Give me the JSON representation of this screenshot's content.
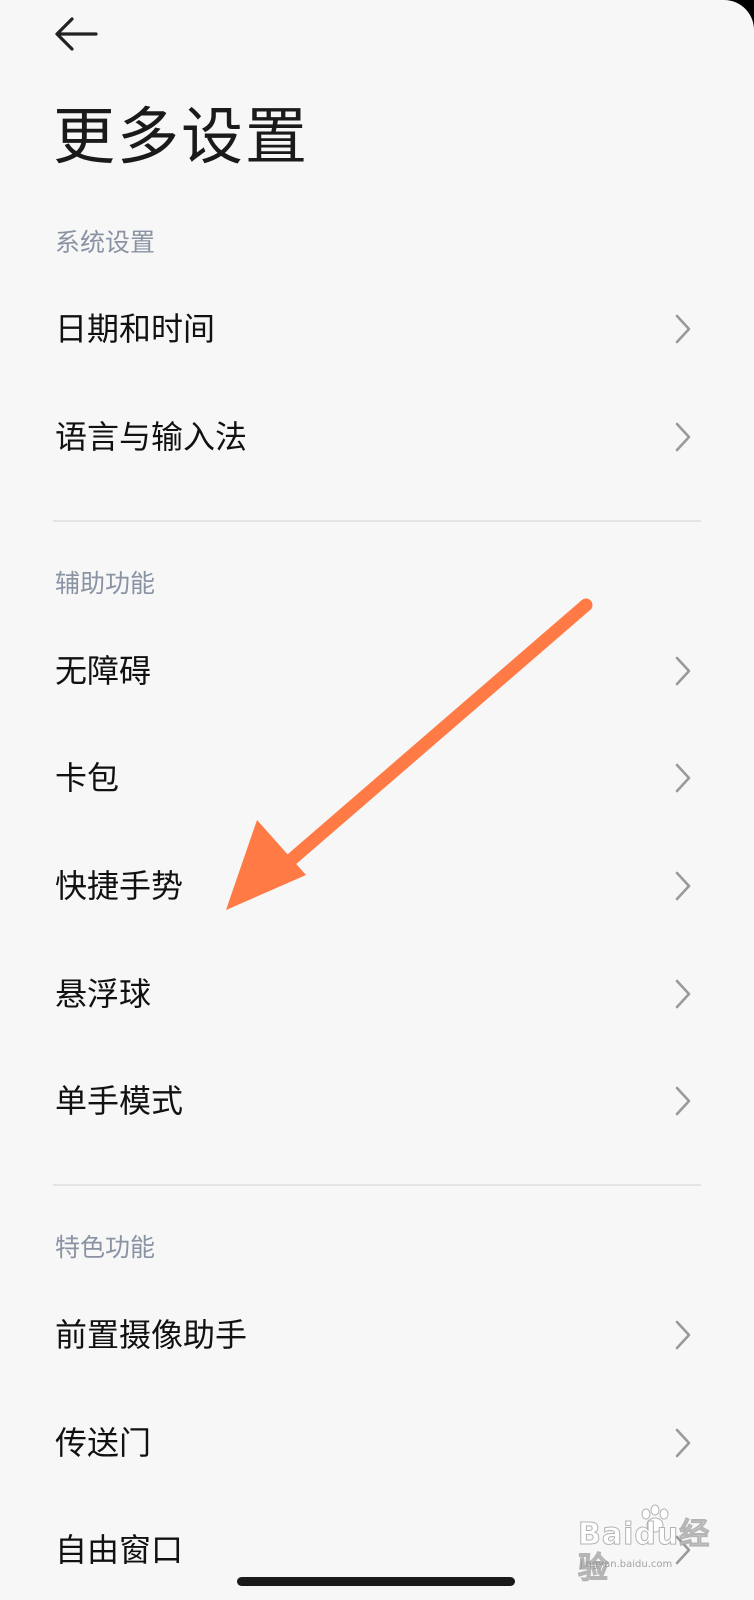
{
  "header": {
    "back_icon": "back-arrow-icon",
    "title": "更多设置"
  },
  "sections": [
    {
      "header": "系统设置",
      "items": [
        {
          "label": "日期和时间"
        },
        {
          "label": "语言与输入法"
        }
      ]
    },
    {
      "header": "辅助功能",
      "items": [
        {
          "label": "无障碍"
        },
        {
          "label": "卡包"
        },
        {
          "label": "快捷手势"
        },
        {
          "label": "悬浮球"
        },
        {
          "label": "单手模式"
        }
      ]
    },
    {
      "header": "特色功能",
      "items": [
        {
          "label": "前置摄像助手"
        },
        {
          "label": "传送门"
        },
        {
          "label": "自由窗口"
        }
      ]
    }
  ],
  "annotation": {
    "type": "arrow",
    "color": "#ff7a45",
    "points_to": "快捷手势"
  },
  "watermark": {
    "brand": "Baidu经验",
    "url": "jingyan.baidu.com"
  },
  "colors": {
    "background": "#f7f7f7",
    "section_header": "#8a93a3",
    "chevron": "#9a9a9a"
  }
}
